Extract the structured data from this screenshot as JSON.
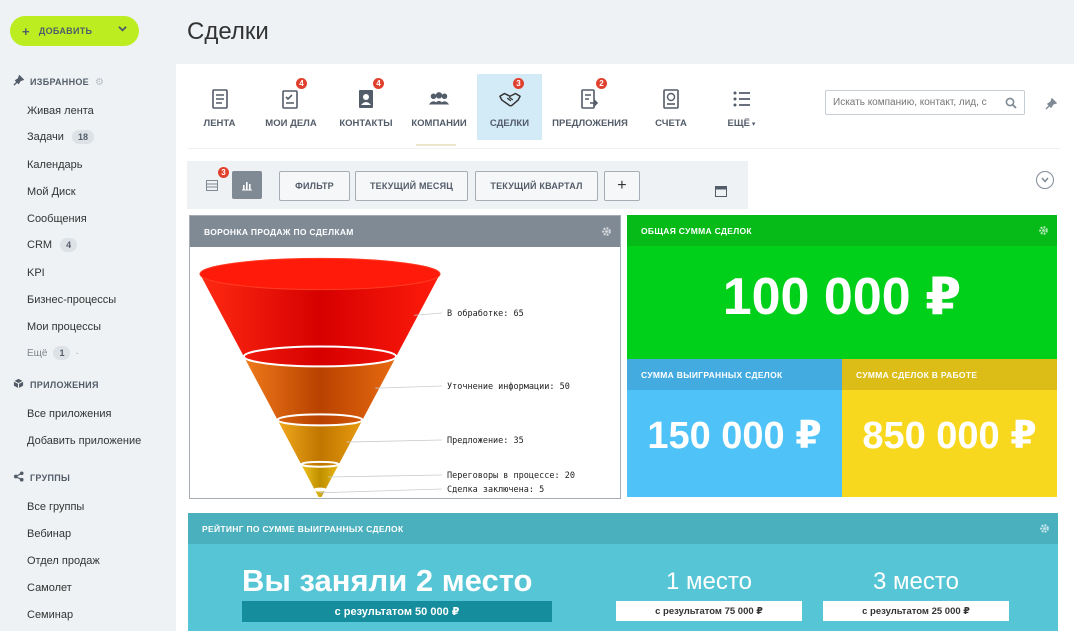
{
  "sidebar": {
    "add_button": "ДОБАВИТЬ",
    "favorites": {
      "title": "ИЗБРАННОЕ",
      "items": [
        {
          "label": "Живая лента",
          "count": null
        },
        {
          "label": "Задачи",
          "count": "18"
        },
        {
          "label": "Календарь",
          "count": null
        },
        {
          "label": "Мой Диск",
          "count": null
        },
        {
          "label": "Сообщения",
          "count": null
        },
        {
          "label": "CRM",
          "count": "4"
        },
        {
          "label": "KPI",
          "count": null
        },
        {
          "label": "Бизнес-процессы",
          "count": null
        },
        {
          "label": "Мои процессы",
          "count": null
        }
      ],
      "more_label": "Ещё",
      "more_count": "1"
    },
    "apps": {
      "title": "ПРИЛОЖЕНИЯ",
      "items": [
        {
          "label": "Все приложения"
        },
        {
          "label": "Добавить приложение"
        }
      ]
    },
    "groups": {
      "title": "ГРУППЫ",
      "items": [
        {
          "label": "Все группы"
        },
        {
          "label": "Вебинар"
        },
        {
          "label": "Отдел продаж"
        },
        {
          "label": "Самолет"
        },
        {
          "label": "Семинар"
        }
      ]
    }
  },
  "header": {
    "title": "Сделки"
  },
  "tabs": [
    {
      "label": "ЛЕНТА",
      "icon": "feed-icon",
      "badge": null
    },
    {
      "label": "МОИ ДЕЛА",
      "icon": "checklist-icon",
      "badge": "4"
    },
    {
      "label": "КОНТАКТЫ",
      "icon": "contact-card-icon",
      "badge": "4"
    },
    {
      "label": "КОМПАНИИ",
      "icon": "people-group-icon",
      "badge": null
    },
    {
      "label": "СДЕЛКИ",
      "icon": "handshake-icon",
      "badge": "3"
    },
    {
      "label": "ПРЕДЛОЖЕНИЯ",
      "icon": "document-arrow-icon",
      "badge": "2"
    },
    {
      "label": "СЧЕТА",
      "icon": "invoice-icon",
      "badge": null
    },
    {
      "label": "ЕЩЁ",
      "icon": "list-icon",
      "badge": null
    }
  ],
  "search": {
    "placeholder": "Искать компанию, контакт, лид, с"
  },
  "filter_bar": {
    "list_badge": "3",
    "buttons": {
      "filter": "ФИЛЬТР",
      "month": "ТЕКУЩИЙ МЕСЯЦ",
      "quarter": "ТЕКУЩИЙ КВАРТАЛ",
      "add": "+"
    }
  },
  "widgets": {
    "funnel_title": "ВОРОНКА ПРОДАЖ ПО СДЕЛКАМ",
    "total_title": "ОБЩАЯ СУММА СДЕЛОК",
    "total_amount": "100 000 ₽",
    "won_title": "СУММА ВЫИГРАННЫХ СДЕЛОК",
    "won_amount": "150 000 ₽",
    "work_title": "СУММА СДЕЛОК В РАБОТЕ",
    "work_amount": "850 000 ₽",
    "rating_title": "РЕЙТИНГ ПО СУММЕ ВЫИГРАННЫХ СДЕЛОК",
    "rating": {
      "main_place": "Вы заняли 2 место",
      "main_result": "с результатом 50 000 ₽",
      "first_place": "1 место",
      "first_result": "с результатом 75 000 ₽",
      "third_place": "3 место",
      "third_result": "с результатом 25 000 ₽"
    }
  },
  "chart_data": {
    "type": "funnel",
    "title": "ВОРОНКА ПРОДАЖ ПО СДЕЛКАМ",
    "categories": [
      "В обработке",
      "Уточнение информации",
      "Предложение",
      "Переговоры в процессе",
      "Сделка заключена"
    ],
    "values": [
      65,
      50,
      35,
      20,
      5
    ],
    "labels": [
      "В обработке: 65",
      "Уточнение информации: 50",
      "Предложение: 35",
      "Переговоры в процессе: 20",
      "Сделка заключена: 5"
    ],
    "colors": [
      "#e30b0b",
      "#d95b07",
      "#d68a00",
      "#cfa400",
      "#c9a800"
    ]
  },
  "colors": {
    "add_button": "#bbed21",
    "badge": "#e0412f",
    "total": "#00d019",
    "won": "#4fc3f7",
    "work": "#f8d81f",
    "rating": "#56c5d5",
    "funnel_header": "#7f8a95"
  }
}
